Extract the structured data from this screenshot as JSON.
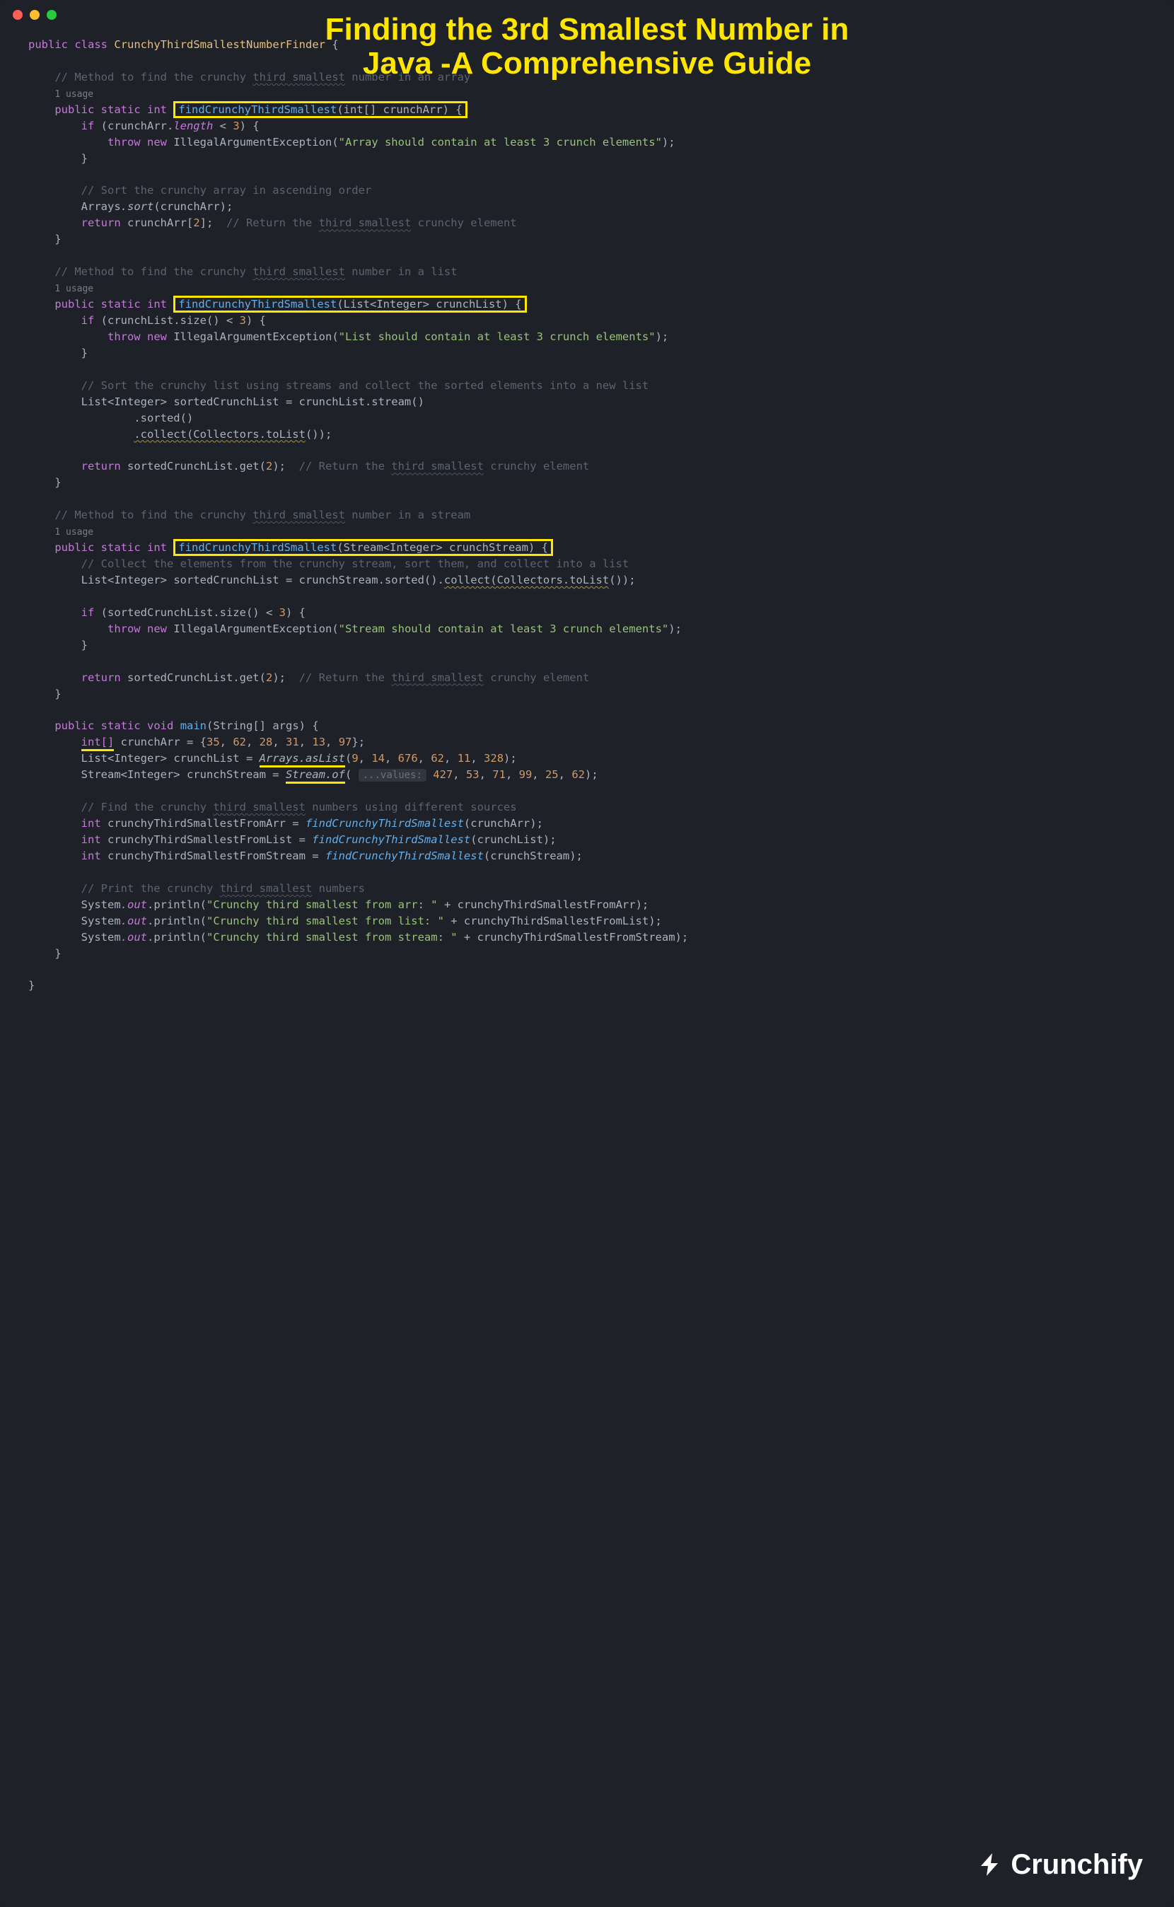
{
  "title_line1": "Finding the 3rd Smallest Number in",
  "title_line2": "Java -A Comprehensive Guide",
  "logo_text": "Crunchify",
  "code": {
    "class_decl_public": "public",
    "class_decl_class": "class",
    "class_name": "CrunchyThirdSmallestNumberFinder",
    "open_brace": "{",
    "close_brace": "}",
    "cmt_m1": "// Method to find the crunchy ",
    "cmt_third_smallest": "third smallest",
    "cmt_m1_tail": " number in an array",
    "usage": "1 usage",
    "public": "public",
    "static": "static",
    "int": "int",
    "void": "void",
    "method_name": "findCrunchyThirdSmallest",
    "param_arr": "(int[] crunchArr) {",
    "if": "if",
    "arr_cond_pre": " (crunchArr.",
    "arr_len": "length",
    "arr_cond_post": " < ",
    "three": "3",
    "cond_close": ") {",
    "throw": "throw",
    "new": "new",
    "iae": "IllegalArgumentException",
    "str_arr": "\"Array should contain at least 3 crunch elements\"",
    "semicolon_paren": ");",
    "cmt_sort_arr": "// Sort the crunchy array in ascending order",
    "arrays": "Arrays",
    "dot_sort": ".sort",
    "sort_arg": "(crunchArr);",
    "return": "return",
    "ret_arr": " crunchArr[",
    "two": "2",
    "ret_arr_close": "];  ",
    "cmt_ret1_pre": "// Return the ",
    "cmt_ret1_post": " crunchy element",
    "cmt_m2_tail": " number in a list",
    "param_list": "(List<Integer> crunchList) {",
    "list_cond": " (crunchList.size() < ",
    "str_list": "\"List should contain at least 3 crunch elements\"",
    "cmt_sort_list": "// Sort the crunchy list using streams and collect the sorted elements into a new list",
    "list_type": "List<Integer>",
    "sorted_assign": " sortedCrunchList = crunchList.stream()",
    "sorted_call": ".sorted()",
    "collect_call": ".collect(Collectors.toList",
    "collect_tail": "());",
    "ret_list": " sortedCrunchList.get(",
    "ret_list_close": ");  ",
    "cmt_m3_tail": " number in a stream",
    "param_stream": "(Stream<Integer> crunchStream) {",
    "cmt_collect_stream": "// Collect the elements from the crunchy stream, sort them, and collect into a list",
    "stream_assign": " sortedCrunchList = crunchStream.sorted().",
    "collect_inline": "collect(Collectors.toList",
    "collect_inline_tail": "());",
    "strm_cond": " (sortedCrunchList.size() < ",
    "str_stream": "\"Stream should contain at least 3 crunch elements\"",
    "main": "main",
    "main_params": "(String[] args) {",
    "intarr_ul": "int[]",
    "arr_decl": " crunchArr = {",
    "arr_vals": [
      "35",
      "62",
      "28",
      "31",
      "13",
      "97"
    ],
    "arr_decl_close": "};",
    "list_decl_pre": " crunchList = ",
    "arrays_aslist": "Arrays.asList",
    "list_vals_open": "(",
    "list_vals": [
      "9",
      "14",
      "676",
      "62",
      "11",
      "328"
    ],
    "list_vals_close": ");",
    "stream_type": "Stream<Integer>",
    "stream_decl": " crunchStream = ",
    "stream_of": "Stream.of",
    "hint_label": "...values:",
    "stream_vals": [
      "427",
      "53",
      "71",
      "99",
      "25",
      "62"
    ],
    "cmt_find": "// Find the crunchy ",
    "cmt_find_tail": " numbers using different sources",
    "v1": " crunchyThirdSmallestFromArr = ",
    "call_m": "findCrunchyThirdSmallest",
    "v1_arg": "(crunchArr);",
    "v2": " crunchyThirdSmallestFromList = ",
    "v2_arg": "(crunchList);",
    "v3": " crunchyThirdSmallestFromStream = ",
    "v3_arg": "(crunchStream);",
    "cmt_print_pre": "// Print the crunchy ",
    "cmt_print_tail": " numbers",
    "sys": "System",
    "out": ".out",
    "println": ".println(",
    "p1_str": "\"Crunchy third smallest from arr: \"",
    "p1_tail": " + crunchyThirdSmallestFromArr);",
    "p2_str": "\"Crunchy third smallest from list: \"",
    "p2_tail": " + crunchyThirdSmallestFromList);",
    "p3_str": "\"Crunchy third smallest from stream: \"",
    "p3_tail": " + crunchyThirdSmallestFromStream);"
  }
}
